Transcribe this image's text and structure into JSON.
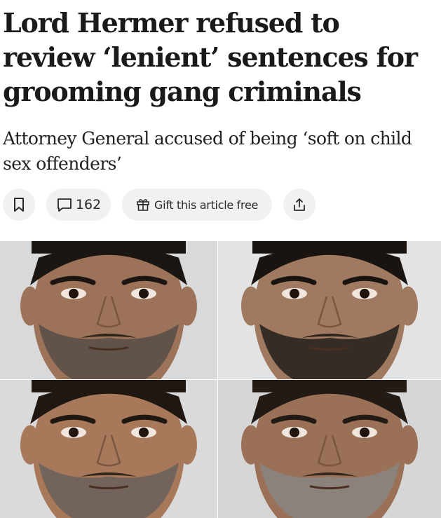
{
  "article": {
    "headline": "Lord Hermer refused to review ‘lenient’ sentences for grooming gang criminals",
    "standfirst": "Attorney General accused of being ‘soft on child sex offenders’"
  },
  "actions": {
    "bookmark_icon": "bookmark-icon",
    "comment_icon": "comment-icon",
    "comment_count": "162",
    "gift_icon": "gift-icon",
    "gift_label": "Gift this article free",
    "share_icon": "share-icon"
  },
  "photos": [
    {
      "name": "mugshot-1",
      "background": "#d9d9d9",
      "skin": "#9c7358",
      "hair": "#1c1612",
      "beard": "#5b5048"
    },
    {
      "name": "mugshot-2",
      "background": "#e3e3e3",
      "skin": "#a07a60",
      "hair": "#1a1410",
      "beard": "#2a2420"
    },
    {
      "name": "mugshot-3",
      "background": "#dadada",
      "skin": "#a8785a",
      "hair": "#1e1712",
      "beard": "#6b625a"
    },
    {
      "name": "mugshot-4",
      "background": "#d6d6d6",
      "skin": "#9a7056",
      "hair": "#221a14",
      "beard": "#8a8480"
    }
  ],
  "colors": {
    "text": "#1a1a1a",
    "pill_background": "#f1f1f1"
  }
}
